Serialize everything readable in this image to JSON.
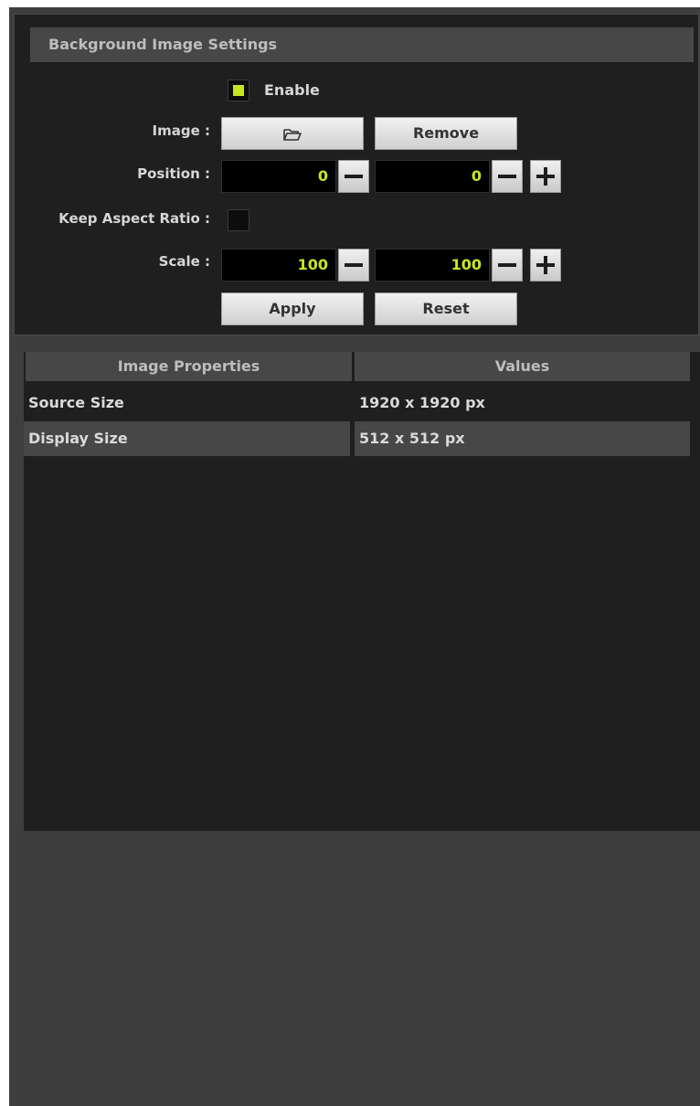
{
  "background_settings": {
    "title": "Background Image Settings",
    "enable": {
      "label": "Enable",
      "checked": true
    },
    "image": {
      "label": "Image :",
      "open_icon": "folder-open-icon",
      "remove_label": "Remove"
    },
    "position": {
      "label": "Position :",
      "x": "0",
      "y": "0"
    },
    "keep_aspect_ratio": {
      "label": "Keep Aspect Ratio :",
      "checked": false
    },
    "scale": {
      "label": "Scale :",
      "x": "100",
      "y": "100"
    },
    "apply_label": "Apply",
    "reset_label": "Reset",
    "accent_color": "#c8e61e"
  },
  "properties": {
    "headers": [
      "Image Properties",
      "Values"
    ],
    "rows": [
      {
        "name": "Source Size",
        "value": "1920 x 1920 px"
      },
      {
        "name": "Display Size",
        "value": "512 x 512 px"
      }
    ]
  }
}
